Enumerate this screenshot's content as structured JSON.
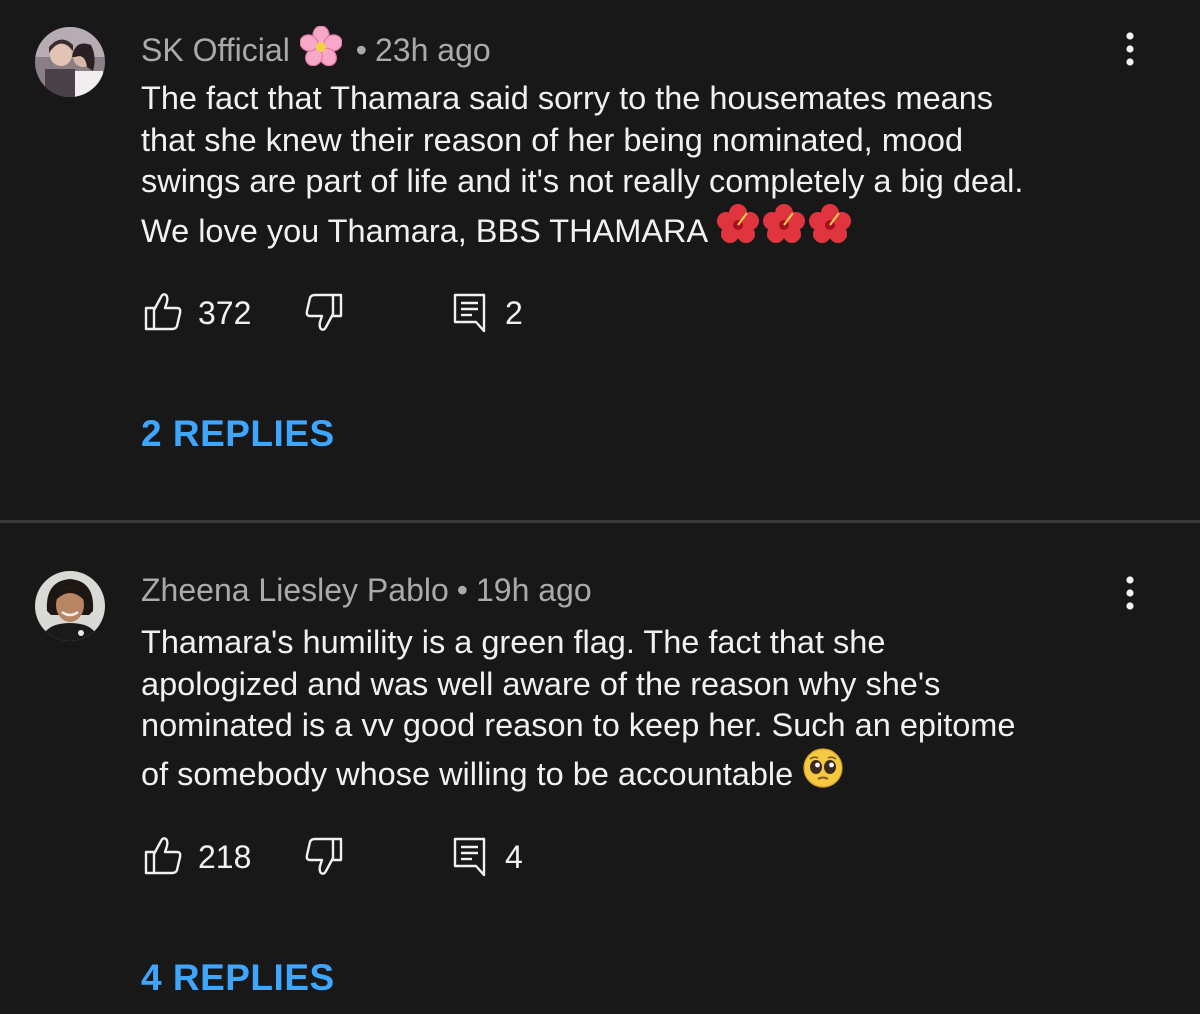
{
  "comments": [
    {
      "author": "SK Official",
      "author_emoji": "cherry-blossom",
      "time": "23h ago",
      "text_lines": [
        "The fact that Thamara said sorry to the housemates means",
        "that she knew their reason of her being nominated, mood",
        "swings are part of life and it's not really completely a big deal.",
        "We love you Thamara, BBS THAMARA"
      ],
      "trailing_emoji": [
        "hibiscus",
        "hibiscus",
        "hibiscus"
      ],
      "likes": "372",
      "reply_count": "2",
      "replies_label": "2 REPLIES"
    },
    {
      "author": "Zheena Liesley Pablo",
      "time": "19h ago",
      "text_lines": [
        "Thamara's humility is a green flag. The fact that she",
        "apologized and was well aware of the reason why she's",
        "nominated is a vv good reason to keep her. Such an epitome",
        "of somebody whose willing to be accountable"
      ],
      "trailing_emoji": [
        "pleading-face"
      ],
      "likes": "218",
      "reply_count": "4",
      "replies_label": "4 REPLIES"
    }
  ],
  "separator": "•",
  "icons": {
    "like": "thumbs-up-icon",
    "dislike": "thumbs-down-icon",
    "reply": "comment-reply-icon",
    "more": "more-vertical-icon"
  },
  "colors": {
    "background": "#181818",
    "text": "#f1f1f1",
    "meta": "#aaaaaa",
    "link": "#3ea6ff",
    "divider": "#3a3a3a"
  }
}
